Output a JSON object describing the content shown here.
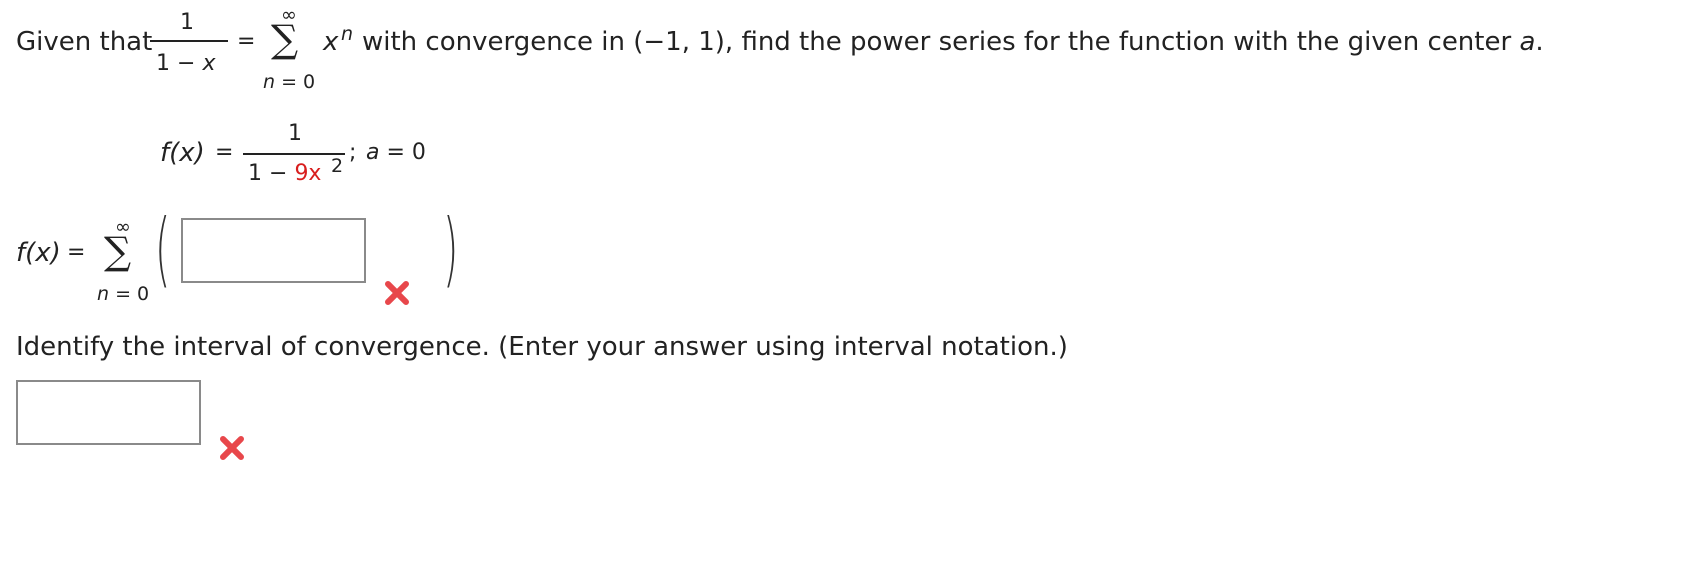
{
  "intro": {
    "given_that": "Given that",
    "frac_num": "1",
    "frac_den_left": "1 −",
    "frac_den_x": "x",
    "equals": "=",
    "sum_top": "∞",
    "sum_sigma": "∑",
    "sum_bottom_n": "n",
    "sum_bottom_rest": "= 0",
    "term_x": "x",
    "term_exp": "n",
    "rest": "with convergence in (−1, 1), find the power series for the function with the given center",
    "center_var": "a",
    "period": "."
  },
  "function": {
    "lhs": "f(x)",
    "equals": "=",
    "num": "1",
    "den_prefix": "1 −",
    "den_coeff": "9x",
    "den_exp": "2",
    "semicolon": ";",
    "center_var": "a",
    "center_rest": "= 0"
  },
  "series_answer": {
    "lhs": "f(x)",
    "equals": "=",
    "sum_top": "∞",
    "sum_sigma": "∑",
    "sum_bottom_n": "n",
    "sum_bottom_rest": "= 0",
    "open_paren": "(",
    "close_paren": ")",
    "input_value": "",
    "status_icon": "x-mark-icon"
  },
  "interval": {
    "prompt": "Identify the interval of convergence. (Enter your answer using interval notation.)",
    "input_value": "",
    "status_icon": "x-mark-icon"
  },
  "colors": {
    "highlight": "#d81e1e",
    "incorrect": "#e8474b"
  }
}
